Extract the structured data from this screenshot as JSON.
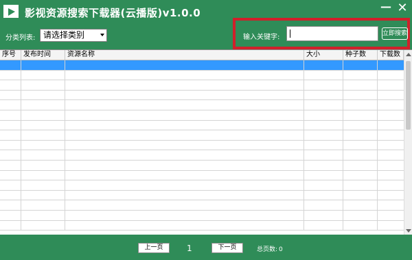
{
  "window": {
    "title": "影视资源搜索下载器(云播版)v1.0.0",
    "minimize_glyph": "—",
    "close_glyph": "✕"
  },
  "toolbar": {
    "category_label": "分类列表:",
    "category_value": "请选择类别",
    "keyword_label": "输入关键字:",
    "keyword_value": "",
    "search_button": "立即搜索"
  },
  "table": {
    "columns": [
      "序号",
      "发布时间",
      "资源名称",
      "大小",
      "种子数",
      "下载数"
    ],
    "selected_row_index": 0
  },
  "pagination": {
    "prev_label": "上一页",
    "current_page": "1",
    "next_label": "下一页",
    "total_label": "总页数:",
    "total_value": "0"
  },
  "colors": {
    "background": "#2f8c58",
    "highlight_border": "#d0202a",
    "selected_row": "#3399ff"
  },
  "icons": {
    "logo": "video-play-icon"
  }
}
